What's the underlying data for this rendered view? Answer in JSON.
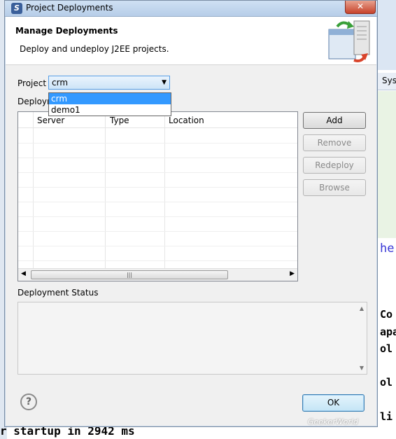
{
  "window": {
    "title": "Project Deployments",
    "close_label": "✕"
  },
  "header": {
    "title": "Manage Deployments",
    "description": "Deploy and undeploy J2EE projects."
  },
  "project": {
    "label": "Project",
    "selected": "crm",
    "options": [
      "crm",
      "demo1"
    ]
  },
  "deployments": {
    "label": "Deployments",
    "columns": [
      "Server",
      "Type",
      "Location"
    ],
    "rows": []
  },
  "buttons": {
    "add": "Add",
    "remove": "Remove",
    "redeploy": "Redeploy",
    "browse": "Browse",
    "ok": "OK"
  },
  "status": {
    "label": "Deployment Status",
    "text": ""
  },
  "background": {
    "console_bottom": "r startup in 2942 ms",
    "right_tab": "Sys",
    "right_fragments": [
      "Co",
      "apa",
      "ol",
      "ol",
      "li"
    ],
    "right_link": "he",
    "watermark": "GeekerWorld"
  }
}
